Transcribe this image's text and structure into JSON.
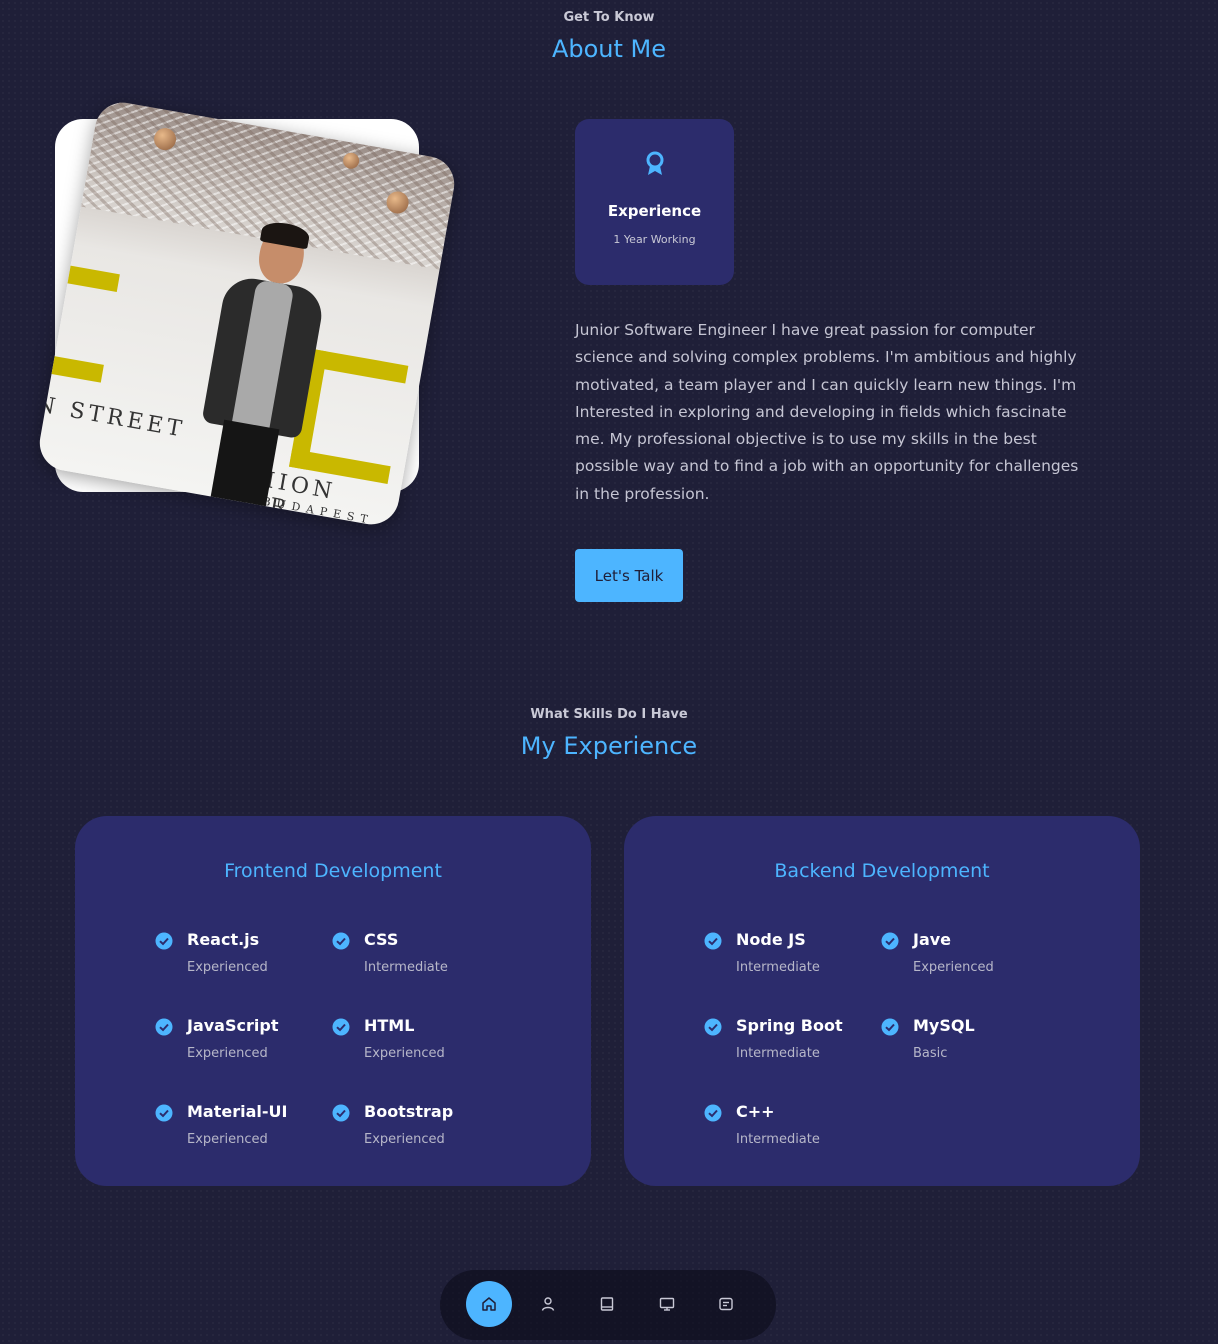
{
  "about": {
    "eyebrow": "Get To Know",
    "title": "About Me",
    "experience_card": {
      "icon": "award-icon",
      "title": "Experience",
      "subtitle": "1 Year Working"
    },
    "bio": "Junior Software Engineer I have great passion for computer science and solving complex problems. I'm ambitious and highly motivated, a team player and I can quickly learn new things. I'm Interested in exploring and developing in fields which fascinate me. My professional objective is to use my skills in the best possible way and to find a job with an opportunity for challenges in the profession.",
    "cta_label": "Let's Talk"
  },
  "experience": {
    "eyebrow": "What Skills Do I Have",
    "title": "My Experience",
    "frontend": {
      "title": "Frontend Development",
      "skills": [
        {
          "name": "React.js",
          "level": "Experienced"
        },
        {
          "name": "CSS",
          "level": "Intermediate"
        },
        {
          "name": "JavaScript",
          "level": "Experienced"
        },
        {
          "name": "HTML",
          "level": "Experienced"
        },
        {
          "name": "Material-UI",
          "level": "Experienced"
        },
        {
          "name": "Bootstrap",
          "level": "Experienced"
        }
      ]
    },
    "backend": {
      "title": "Backend Development",
      "skills": [
        {
          "name": "Node JS",
          "level": "Intermediate"
        },
        {
          "name": "Jave",
          "level": "Experienced"
        },
        {
          "name": "Spring Boot",
          "level": "Intermediate"
        },
        {
          "name": "MySQL",
          "level": "Basic"
        },
        {
          "name": "C++",
          "level": "Intermediate"
        }
      ]
    }
  },
  "nav": {
    "items": [
      "home-icon",
      "user-icon",
      "book-icon",
      "monitor-icon",
      "message-icon"
    ],
    "active": "home-icon"
  },
  "colors": {
    "background": "#1f1f38",
    "accent": "#4db5ff",
    "card": "#2c2c6c",
    "text_muted": "#c5c5d3"
  }
}
